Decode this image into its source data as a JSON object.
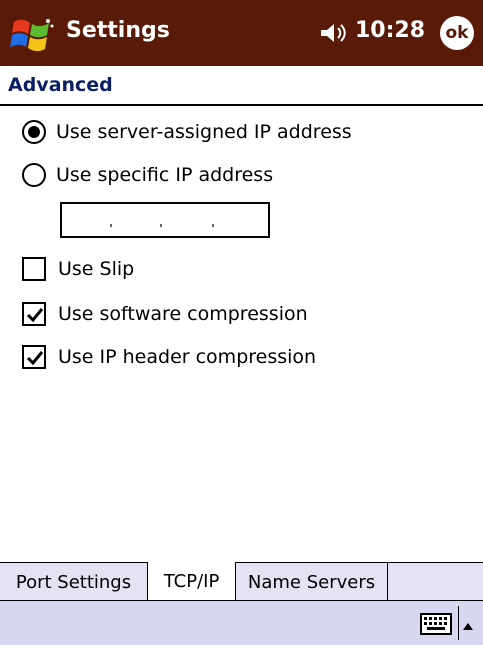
{
  "titlebar": {
    "title": "Settings",
    "time": "10:28",
    "ok_label": "ok",
    "color": "#5a1a08"
  },
  "section": {
    "title": "Advanced"
  },
  "options": {
    "server_ip": {
      "label": "Use server-assigned IP address",
      "selected": true
    },
    "specific_ip": {
      "label": "Use specific IP address",
      "selected": false
    },
    "ip_field": {
      "value": ". . ."
    },
    "slip": {
      "label": "Use Slip",
      "checked": false
    },
    "software_compression": {
      "label": "Use software compression",
      "checked": true
    },
    "ip_header_compression": {
      "label": "Use IP header compression",
      "checked": true
    }
  },
  "tabs": [
    {
      "label": "Port Settings",
      "active": false
    },
    {
      "label": "TCP/IP",
      "active": true
    },
    {
      "label": "Name Servers",
      "active": false
    }
  ],
  "icons": {
    "start": "windows-flag-icon",
    "volume": "speaker-icon",
    "keyboard": "keyboard-icon",
    "sip_arrow": "arrow-up-icon"
  }
}
